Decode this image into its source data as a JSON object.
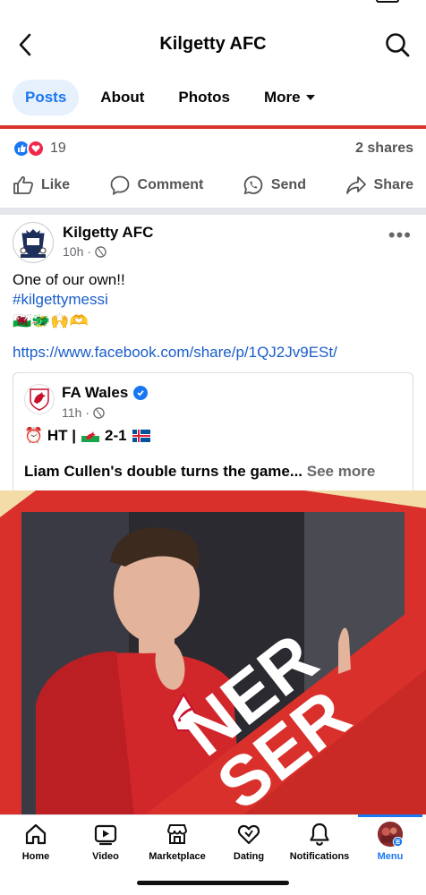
{
  "header": {
    "title": "Kilgetty AFC"
  },
  "tabs": [
    {
      "label": "Posts"
    },
    {
      "label": "About"
    },
    {
      "label": "Photos"
    },
    {
      "label": "More"
    }
  ],
  "reactions": {
    "count": "19",
    "shares": "2 shares"
  },
  "actions": {
    "like": "Like",
    "comment": "Comment",
    "send": "Send",
    "share": "Share"
  },
  "post": {
    "page_name": "Kilgetty AFC",
    "time": "10h ·",
    "line1": "One of our own!!",
    "hashtag": "#kilgettymessi",
    "emojis": "🏴󠁧󠁢󠁷󠁬󠁳󠁿🐲🙌🫶",
    "link": "https://www.facebook.com/share/p/1QJ2Jv9ESt/"
  },
  "shared": {
    "name": "FA Wales",
    "time": "11h ·",
    "score_prefix": "⏰ HT |",
    "score": "2-1",
    "snippet": "Liam Cullen's double turns the game...",
    "see_more": "See more"
  },
  "photo": {
    "overlay_text": "NER SER"
  },
  "nav": [
    {
      "label": "Home"
    },
    {
      "label": "Video"
    },
    {
      "label": "Marketplace"
    },
    {
      "label": "Dating"
    },
    {
      "label": "Notifications"
    },
    {
      "label": "Menu"
    }
  ],
  "colors": {
    "accent": "#1877f2",
    "brand_red": "#d8362c",
    "hashtag": "#1a5dc9"
  }
}
